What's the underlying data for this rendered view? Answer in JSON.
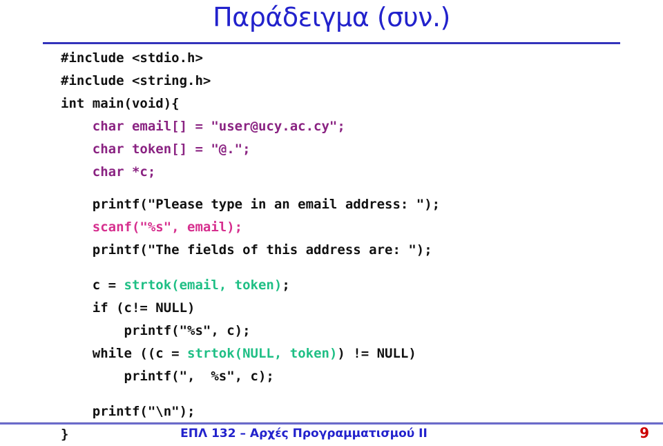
{
  "slide": {
    "title": "Παράδειγμα (συν.)",
    "title_color": "#2222CC",
    "rule_color": "#3333BB",
    "background": "#FFFFFF"
  },
  "code": {
    "language": "C",
    "colors": {
      "default": "#111111",
      "declaration": "#8A2382",
      "input_call": "#D62F8E",
      "library_call": "#1FBF85"
    },
    "lines": [
      {
        "id": "l1",
        "indent": 0,
        "segments": [
          {
            "text": "#include <stdio.h>",
            "color": "default"
          }
        ]
      },
      {
        "id": "l2",
        "indent": 0,
        "segments": [
          {
            "text": "#include <string.h>",
            "color": "default"
          }
        ]
      },
      {
        "id": "l3",
        "indent": 0,
        "segments": [
          {
            "text": "int main(void){",
            "color": "default"
          }
        ]
      },
      {
        "id": "l4",
        "indent": 1,
        "segments": [
          {
            "text": "char email[] = \"user@ucy.ac.cy\";",
            "color": "declaration"
          }
        ]
      },
      {
        "id": "l5",
        "indent": 1,
        "segments": [
          {
            "text": "char token[] = \"@.\";",
            "color": "declaration"
          }
        ]
      },
      {
        "id": "l6",
        "indent": 1,
        "segments": [
          {
            "text": "char *c;",
            "color": "declaration"
          }
        ]
      },
      {
        "id": "l7",
        "indent": 1,
        "segments": [
          {
            "text": "printf(\"Please type in an email address: \");",
            "color": "default"
          }
        ]
      },
      {
        "id": "l8",
        "indent": 1,
        "segments": [
          {
            "text": "scanf(\"%s\", email);",
            "color": "input_call"
          }
        ]
      },
      {
        "id": "l9",
        "indent": 1,
        "segments": [
          {
            "text": "printf(\"The fields of this address are: \");",
            "color": "default"
          }
        ]
      },
      {
        "id": "l10",
        "indent": 1,
        "segments": [
          {
            "text": "c = ",
            "color": "default"
          },
          {
            "text": "strtok(email, token)",
            "color": "library_call"
          },
          {
            "text": ";",
            "color": "default"
          }
        ]
      },
      {
        "id": "l11",
        "indent": 1,
        "segments": [
          {
            "text": "if (c!= NULL)",
            "color": "default"
          }
        ]
      },
      {
        "id": "l12",
        "indent": 2,
        "segments": [
          {
            "text": "printf(\"%s\", c);",
            "color": "default"
          }
        ]
      },
      {
        "id": "l13",
        "indent": 1,
        "segments": [
          {
            "text": "while ((c = ",
            "color": "default"
          },
          {
            "text": "strtok(NULL, token)",
            "color": "library_call"
          },
          {
            "text": ") != NULL)",
            "color": "default"
          }
        ]
      },
      {
        "id": "l14",
        "indent": 2,
        "segments": [
          {
            "text": "printf(\",  %s\", c);",
            "color": "default"
          }
        ]
      },
      {
        "id": "l15",
        "indent": 1,
        "segments": [
          {
            "text": "printf(\"\\n\");",
            "color": "default"
          }
        ]
      },
      {
        "id": "l16",
        "indent": 0,
        "segments": [
          {
            "text": "}",
            "color": "default"
          }
        ]
      }
    ]
  },
  "footer": {
    "course": "ΕΠΛ 132 – Αρχές Προγραμματισμού ΙΙ",
    "course_color": "#2222CC",
    "page_number": "9",
    "page_number_color": "#CC0000"
  }
}
